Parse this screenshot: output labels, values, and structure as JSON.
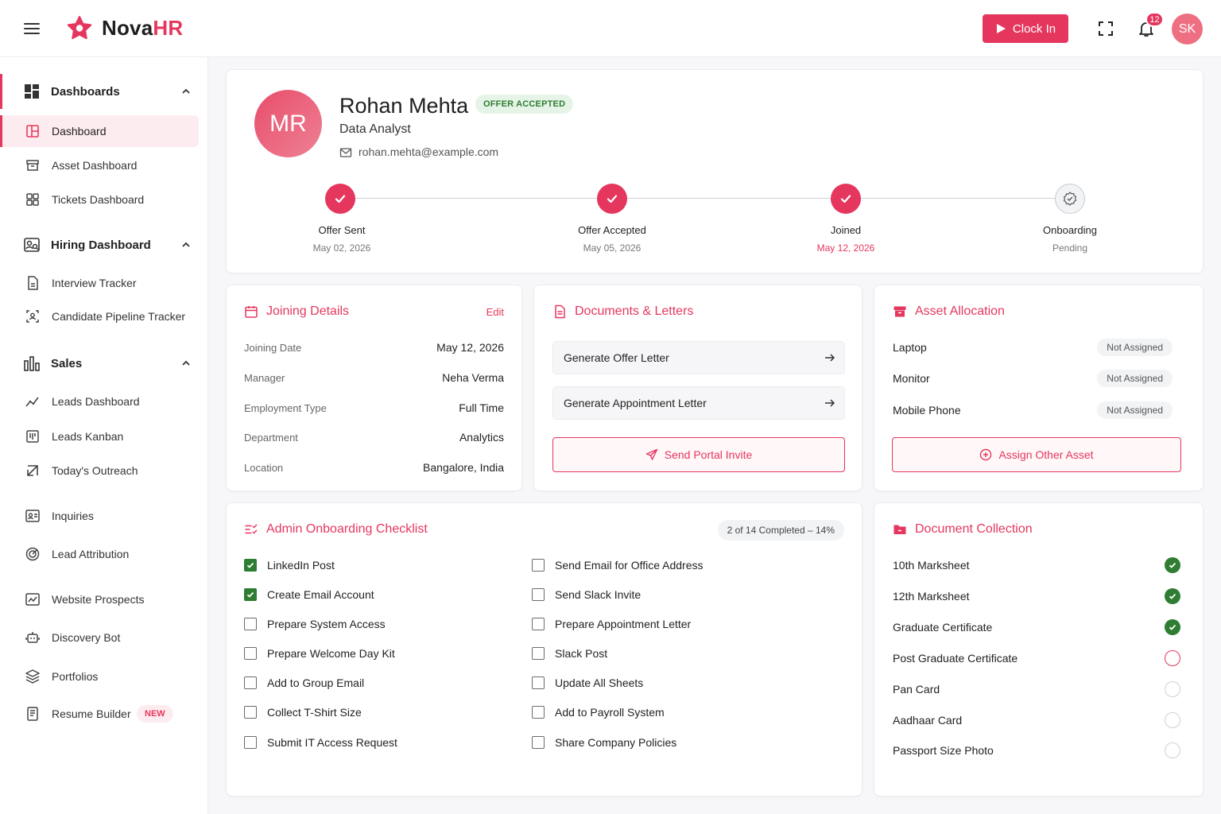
{
  "app": {
    "name_part1": "Nova",
    "name_part2": "HR",
    "brand_color": "#e5375e"
  },
  "header": {
    "clock_in_label": "Clock In",
    "notification_count": "12",
    "user_initials": "SK"
  },
  "sidebar": {
    "sections": [
      {
        "label": "Dashboards",
        "icon": "dashboard-grid-icon",
        "items": [
          {
            "label": "Dashboard",
            "icon": "layout-icon",
            "active": true
          },
          {
            "label": "Asset Dashboard",
            "icon": "archive-icon"
          },
          {
            "label": "Tickets Dashboard",
            "icon": "grid-icon"
          }
        ]
      },
      {
        "label": "Hiring Dashboard",
        "icon": "user-search-icon",
        "items": [
          {
            "label": "Interview Tracker",
            "icon": "file-icon"
          },
          {
            "label": "Candidate Pipeline Tracker",
            "icon": "user-scan-icon"
          }
        ]
      },
      {
        "label": "Sales",
        "icon": "bar-chart-icon",
        "items": [
          {
            "label": "Leads Dashboard",
            "icon": "trend-icon"
          },
          {
            "label": "Leads Kanban",
            "icon": "kanban-icon"
          },
          {
            "label": "Today's Outreach",
            "icon": "outreach-icon"
          }
        ]
      }
    ],
    "standalone": [
      {
        "label": "Inquiries",
        "icon": "contact-card-icon"
      },
      {
        "label": "Lead Attribution",
        "icon": "target-icon"
      },
      {
        "label": "Website Prospects",
        "icon": "image-chart-icon"
      },
      {
        "label": "Discovery Bot",
        "icon": "bot-icon"
      },
      {
        "label": "Portfolios",
        "icon": "layers-icon"
      },
      {
        "label": "Resume Builder",
        "icon": "resume-icon",
        "badge": "NEW"
      }
    ]
  },
  "profile": {
    "initials": "MR",
    "name": "Rohan Mehta",
    "status": "OFFER ACCEPTED",
    "role": "Data Analyst",
    "email": "rohan.mehta@example.com",
    "steps": [
      {
        "label": "Offer Sent",
        "date": "May 02, 2026",
        "state": "done"
      },
      {
        "label": "Offer Accepted",
        "date": "May 05, 2026",
        "state": "done"
      },
      {
        "label": "Joined",
        "date": "May 12, 2026",
        "state": "done"
      },
      {
        "label": "Onboarding",
        "date": "Pending",
        "state": "pending"
      }
    ]
  },
  "joining": {
    "title": "Joining Details",
    "edit_label": "Edit",
    "rows": [
      {
        "key": "Joining Date",
        "value": "May 12, 2026"
      },
      {
        "key": "Manager",
        "value": "Neha Verma"
      },
      {
        "key": "Employment Type",
        "value": "Full Time"
      },
      {
        "key": "Department",
        "value": "Analytics"
      },
      {
        "key": "Location",
        "value": "Bangalore, India"
      }
    ]
  },
  "documents": {
    "title": "Documents & Letters",
    "buttons": [
      "Generate Offer Letter",
      "Generate Appointment Letter"
    ],
    "invite_label": "Send Portal Invite"
  },
  "assets": {
    "title": "Asset Allocation",
    "rows": [
      {
        "name": "Laptop",
        "status": "Not Assigned"
      },
      {
        "name": "Monitor",
        "status": "Not Assigned"
      },
      {
        "name": "Mobile Phone",
        "status": "Not Assigned"
      }
    ],
    "assign_label": "Assign Other Asset"
  },
  "checklist": {
    "title": "Admin Onboarding Checklist",
    "progress": "2 of 14 Completed – 14%",
    "left": [
      {
        "label": "LinkedIn Post",
        "checked": true
      },
      {
        "label": "Create Email Account",
        "checked": true
      },
      {
        "label": "Prepare System Access",
        "checked": false
      },
      {
        "label": "Prepare Welcome Day Kit",
        "checked": false
      },
      {
        "label": "Add to Group Email",
        "checked": false
      },
      {
        "label": "Collect T-Shirt Size",
        "checked": false
      },
      {
        "label": "Submit IT Access Request",
        "checked": false
      }
    ],
    "right": [
      {
        "label": "Send Email for Office Address",
        "checked": false
      },
      {
        "label": "Send Slack Invite",
        "checked": false
      },
      {
        "label": "Prepare Appointment Letter",
        "checked": false
      },
      {
        "label": "Slack Post",
        "checked": false
      },
      {
        "label": "Update All Sheets",
        "checked": false
      },
      {
        "label": "Add to Payroll System",
        "checked": false
      },
      {
        "label": "Share Company Policies",
        "checked": false
      }
    ]
  },
  "doc_collection": {
    "title": "Document Collection",
    "rows": [
      {
        "name": "10th Marksheet",
        "status": "received"
      },
      {
        "name": "12th Marksheet",
        "status": "received"
      },
      {
        "name": "Graduate Certificate",
        "status": "received"
      },
      {
        "name": "Post Graduate Certificate",
        "status": "missing"
      },
      {
        "name": "Pan Card",
        "status": "not-submitted"
      },
      {
        "name": "Aadhaar Card",
        "status": "not-submitted"
      },
      {
        "name": "Passport Size Photo",
        "status": "not-submitted"
      }
    ]
  }
}
